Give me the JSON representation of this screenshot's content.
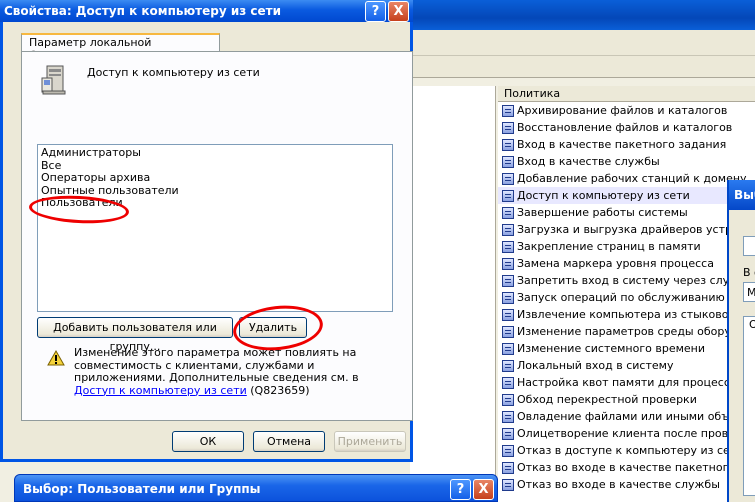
{
  "background_window": {
    "policy_column_header": "Политика",
    "policies": [
      "Архивирование файлов и каталогов",
      "Восстановление файлов и каталогов",
      "Вход в качестве пакетного задания",
      "Вход в качестве службы",
      "Добавление рабочих станций к домену",
      "Доступ к компьютеру из сети",
      "Завершение работы системы",
      "Загрузка и выгрузка драйверов устройств",
      "Закрепление страниц в памяти",
      "Замена маркера уровня процесса",
      "Запретить вход в систему через службу",
      "Запуск операций по обслуживанию тома",
      "Извлечение компьютера из стыковочного",
      "Изменение параметров среды оборудования",
      "Изменение системного времени",
      "Локальный вход в систему",
      "Настройка квот памяти для процесса",
      "Обход перекрестной проверки",
      "Овладение файлами или иными объектами",
      "Олицетворение клиента после проверки",
      "Отказ в доступе к компьютеру из сети",
      "Отказ во входе в качестве пакетного задания",
      "Отказ во входе в качестве службы"
    ],
    "selected_policy_index": 5,
    "right_dialog": {
      "title": "Выб",
      "text1": "П",
      "text2": "В о",
      "text3": "М",
      "text4": "О"
    }
  },
  "dialog": {
    "title": "Свойства: Доступ к компьютеру из сети",
    "help_button": "?",
    "close_button": "X",
    "tab_label": "Параметр локальной безопасности",
    "policy_name": "Доступ к компьютеру из сети",
    "members": [
      "Администраторы",
      "Все",
      "Операторы архива",
      "Опытные пользователи",
      "Пользователи"
    ],
    "add_button": "Добавить пользователя или группу...",
    "remove_button": "Удалить",
    "warning_text": "Изменение этого параметра может повлиять на совместимость с клиентами, службами и приложениями. Дополнительные сведения см. в ",
    "warning_link": "Доступ к компьютеру из сети",
    "warning_suffix": " (Q823659)",
    "ok_button": "ОК",
    "cancel_button": "Отмена",
    "apply_button": "Применить"
  },
  "select_dialog": {
    "title": "Выбор: Пользователи или Группы",
    "help_button": "?",
    "close_button": "X"
  },
  "colors": {
    "title_blue": "#0a5ae0",
    "annotation_red": "#e00000",
    "link_blue": "#0000ff"
  }
}
